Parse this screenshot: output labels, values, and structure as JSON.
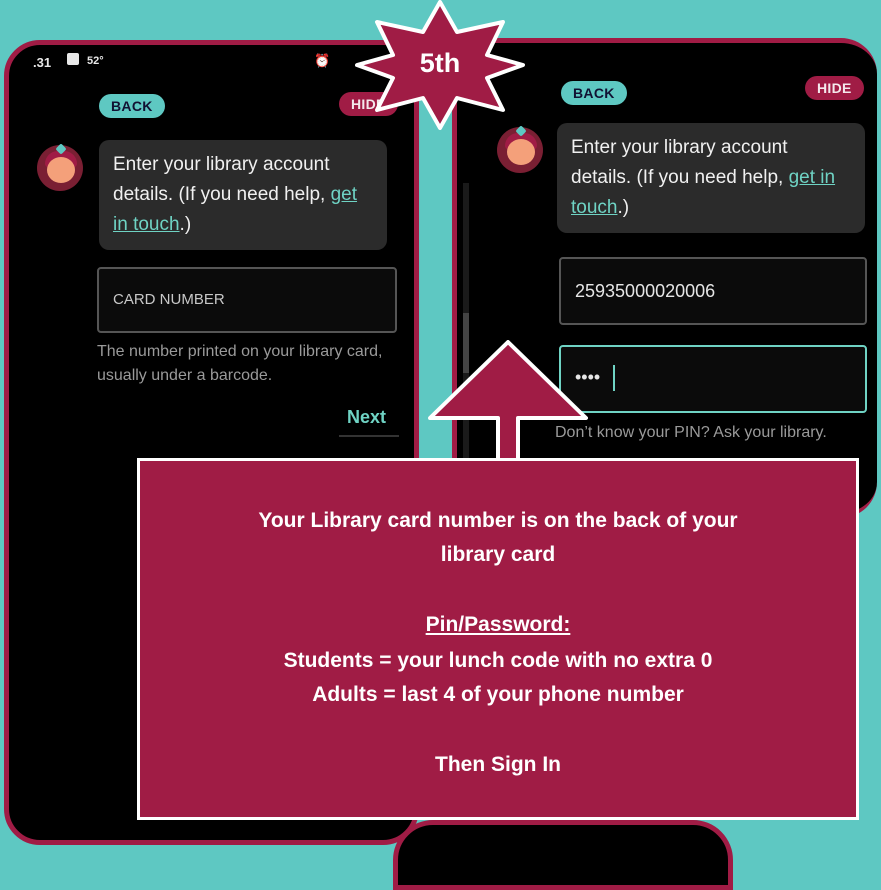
{
  "step_badge": "5th",
  "left_screen": {
    "status_time": ".31",
    "status_temp": "52°",
    "back_label": "BACK",
    "hide_label": "HIDE",
    "prompt_text": "Enter your library account details. (If you need help, ",
    "prompt_link": "get in touch",
    "prompt_end": ".)",
    "card_placeholder": "CARD NUMBER",
    "card_helper": "The number printed on your library card, usually under a barcode.",
    "next_label": "Next"
  },
  "right_screen": {
    "back_label": "BACK",
    "hide_label": "HIDE",
    "prompt_text": "Enter your library account details. (If you need help, ",
    "prompt_link": "get in touch",
    "prompt_end": ".)",
    "card_value": "25935000020006",
    "pin_value": "••••",
    "pin_helper": "Don’t know your PIN? Ask your library."
  },
  "info_box": {
    "line1": "Your Library card number is on the back of your",
    "line2": "library card",
    "heading": "Pin/Password:",
    "students": "Students = your lunch code with no extra 0",
    "adults": "Adults = last 4  of your phone number",
    "footer": "Then Sign In"
  },
  "colors": {
    "background": "#5ec8c2",
    "accent": "#a01c45",
    "link": "#6fd3c4"
  }
}
